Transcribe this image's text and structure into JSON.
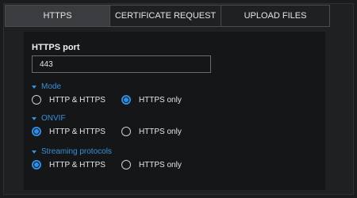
{
  "tabs": [
    {
      "label": "HTTPS",
      "active": true
    },
    {
      "label": "CERTIFICATE REQUEST",
      "active": false
    },
    {
      "label": "UPLOAD FILES",
      "active": false
    }
  ],
  "https_port": {
    "label": "HTTPS port",
    "value": "443"
  },
  "sections": [
    {
      "title": "Mode",
      "options": [
        "HTTP & HTTPS",
        "HTTPS only"
      ],
      "selected": "HTTPS only"
    },
    {
      "title": "ONVIF",
      "options": [
        "HTTP & HTTPS",
        "HTTPS only"
      ],
      "selected": "HTTP & HTTPS"
    },
    {
      "title": "Streaming protocols",
      "options": [
        "HTTP & HTTPS",
        "HTTPS only"
      ],
      "selected": "HTTP & HTTPS"
    }
  ],
  "colors": {
    "accent": "#2f8de4",
    "section_title": "#3a8fdc",
    "background": "#1b1c1e"
  },
  "icons": {
    "section_toggle": "chevron-down-icon"
  }
}
